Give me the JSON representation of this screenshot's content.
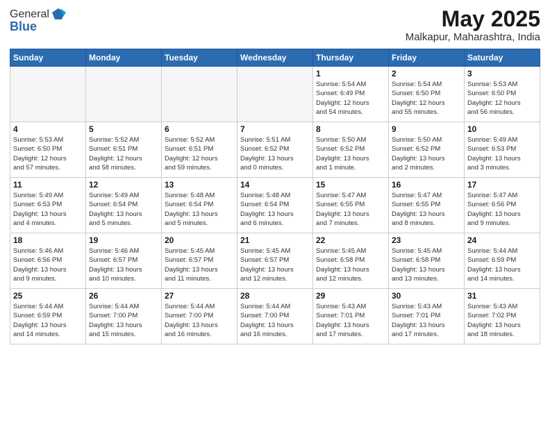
{
  "logo": {
    "general": "General",
    "blue": "Blue"
  },
  "header": {
    "title": "May 2025",
    "subtitle": "Malkapur, Maharashtra, India"
  },
  "weekdays": [
    "Sunday",
    "Monday",
    "Tuesday",
    "Wednesday",
    "Thursday",
    "Friday",
    "Saturday"
  ],
  "weeks": [
    [
      {
        "day": "",
        "info": ""
      },
      {
        "day": "",
        "info": ""
      },
      {
        "day": "",
        "info": ""
      },
      {
        "day": "",
        "info": ""
      },
      {
        "day": "1",
        "info": "Sunrise: 5:54 AM\nSunset: 6:49 PM\nDaylight: 12 hours\nand 54 minutes."
      },
      {
        "day": "2",
        "info": "Sunrise: 5:54 AM\nSunset: 6:50 PM\nDaylight: 12 hours\nand 55 minutes."
      },
      {
        "day": "3",
        "info": "Sunrise: 5:53 AM\nSunset: 6:50 PM\nDaylight: 12 hours\nand 56 minutes."
      }
    ],
    [
      {
        "day": "4",
        "info": "Sunrise: 5:53 AM\nSunset: 6:50 PM\nDaylight: 12 hours\nand 57 minutes."
      },
      {
        "day": "5",
        "info": "Sunrise: 5:52 AM\nSunset: 6:51 PM\nDaylight: 12 hours\nand 58 minutes."
      },
      {
        "day": "6",
        "info": "Sunrise: 5:52 AM\nSunset: 6:51 PM\nDaylight: 12 hours\nand 59 minutes."
      },
      {
        "day": "7",
        "info": "Sunrise: 5:51 AM\nSunset: 6:52 PM\nDaylight: 13 hours\nand 0 minutes."
      },
      {
        "day": "8",
        "info": "Sunrise: 5:50 AM\nSunset: 6:52 PM\nDaylight: 13 hours\nand 1 minute."
      },
      {
        "day": "9",
        "info": "Sunrise: 5:50 AM\nSunset: 6:52 PM\nDaylight: 13 hours\nand 2 minutes."
      },
      {
        "day": "10",
        "info": "Sunrise: 5:49 AM\nSunset: 6:53 PM\nDaylight: 13 hours\nand 3 minutes."
      }
    ],
    [
      {
        "day": "11",
        "info": "Sunrise: 5:49 AM\nSunset: 6:53 PM\nDaylight: 13 hours\nand 4 minutes."
      },
      {
        "day": "12",
        "info": "Sunrise: 5:49 AM\nSunset: 6:54 PM\nDaylight: 13 hours\nand 5 minutes."
      },
      {
        "day": "13",
        "info": "Sunrise: 5:48 AM\nSunset: 6:54 PM\nDaylight: 13 hours\nand 5 minutes."
      },
      {
        "day": "14",
        "info": "Sunrise: 5:48 AM\nSunset: 6:54 PM\nDaylight: 13 hours\nand 6 minutes."
      },
      {
        "day": "15",
        "info": "Sunrise: 5:47 AM\nSunset: 6:55 PM\nDaylight: 13 hours\nand 7 minutes."
      },
      {
        "day": "16",
        "info": "Sunrise: 5:47 AM\nSunset: 6:55 PM\nDaylight: 13 hours\nand 8 minutes."
      },
      {
        "day": "17",
        "info": "Sunrise: 5:47 AM\nSunset: 6:56 PM\nDaylight: 13 hours\nand 9 minutes."
      }
    ],
    [
      {
        "day": "18",
        "info": "Sunrise: 5:46 AM\nSunset: 6:56 PM\nDaylight: 13 hours\nand 9 minutes."
      },
      {
        "day": "19",
        "info": "Sunrise: 5:46 AM\nSunset: 6:57 PM\nDaylight: 13 hours\nand 10 minutes."
      },
      {
        "day": "20",
        "info": "Sunrise: 5:45 AM\nSunset: 6:57 PM\nDaylight: 13 hours\nand 11 minutes."
      },
      {
        "day": "21",
        "info": "Sunrise: 5:45 AM\nSunset: 6:57 PM\nDaylight: 13 hours\nand 12 minutes."
      },
      {
        "day": "22",
        "info": "Sunrise: 5:45 AM\nSunset: 6:58 PM\nDaylight: 13 hours\nand 12 minutes."
      },
      {
        "day": "23",
        "info": "Sunrise: 5:45 AM\nSunset: 6:58 PM\nDaylight: 13 hours\nand 13 minutes."
      },
      {
        "day": "24",
        "info": "Sunrise: 5:44 AM\nSunset: 6:59 PM\nDaylight: 13 hours\nand 14 minutes."
      }
    ],
    [
      {
        "day": "25",
        "info": "Sunrise: 5:44 AM\nSunset: 6:59 PM\nDaylight: 13 hours\nand 14 minutes."
      },
      {
        "day": "26",
        "info": "Sunrise: 5:44 AM\nSunset: 7:00 PM\nDaylight: 13 hours\nand 15 minutes."
      },
      {
        "day": "27",
        "info": "Sunrise: 5:44 AM\nSunset: 7:00 PM\nDaylight: 13 hours\nand 16 minutes."
      },
      {
        "day": "28",
        "info": "Sunrise: 5:44 AM\nSunset: 7:00 PM\nDaylight: 13 hours\nand 16 minutes."
      },
      {
        "day": "29",
        "info": "Sunrise: 5:43 AM\nSunset: 7:01 PM\nDaylight: 13 hours\nand 17 minutes."
      },
      {
        "day": "30",
        "info": "Sunrise: 5:43 AM\nSunset: 7:01 PM\nDaylight: 13 hours\nand 17 minutes."
      },
      {
        "day": "31",
        "info": "Sunrise: 5:43 AM\nSunset: 7:02 PM\nDaylight: 13 hours\nand 18 minutes."
      }
    ]
  ]
}
